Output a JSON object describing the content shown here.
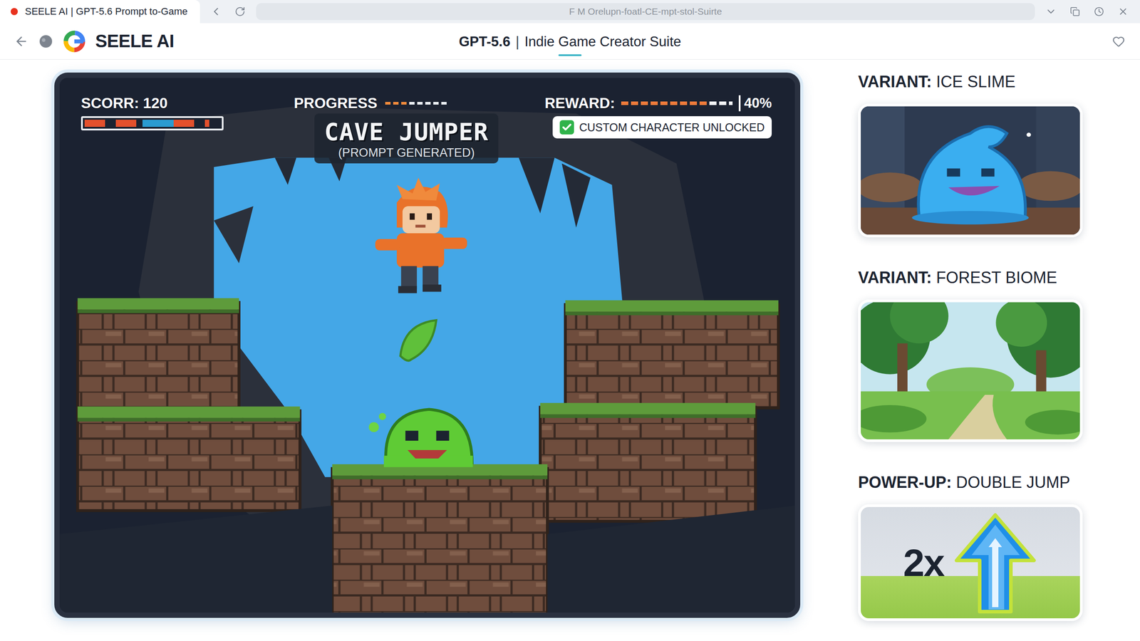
{
  "browser": {
    "tab_title": "SEELE AI | GPT-5.6 Prompt to-Game",
    "address": "F M Orelupn-foatl-CE-mpt-stol-Suirte"
  },
  "header": {
    "brand": "SEELE AI",
    "model": "GPT-5.6",
    "separator": "|",
    "suite": "Indie Game Creator Suite"
  },
  "game": {
    "title": "CAVE JUMPER",
    "subtitle": "(PROMPT GENERATED)",
    "score": {
      "label": "SCORR: 120",
      "level": 0.92
    },
    "progress": {
      "label": "PROGRESS",
      "level": 0.35
    },
    "reward": {
      "label": "REWARD:",
      "level": 0.78,
      "reading": "40%"
    },
    "badge": {
      "text": "CUSTOM CHARACTER UNLOCKED",
      "checked": true
    }
  },
  "cards": [
    {
      "kind": "creature",
      "prefix": "VARIANT:",
      "name": "ICE SLIME"
    },
    {
      "kind": "biome",
      "prefix": "VARIANT:",
      "name": "FOREST BIOME"
    },
    {
      "kind": "powerup",
      "prefix": "POWER-UP:",
      "name": "DOUBLE JUMP",
      "multiplier": "2x"
    }
  ]
}
